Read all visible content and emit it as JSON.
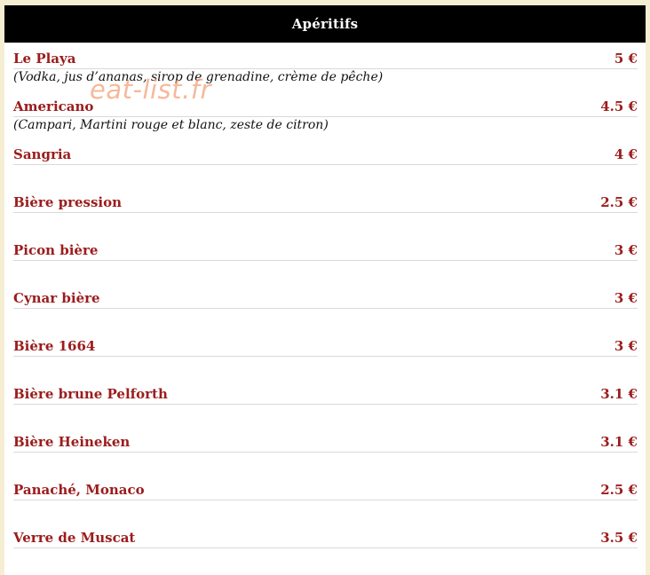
{
  "header": {
    "title": "Apéritifs"
  },
  "watermark": "eat-list.fr",
  "items": [
    {
      "name": "Le Playa",
      "price": "5 €",
      "desc": "(Vodka, jus d’ananas, sirop de grenadine, crème de pêche)"
    },
    {
      "name": "Americano",
      "price": "4.5 €",
      "desc": "(Campari, Martini rouge et blanc, zeste de citron)"
    },
    {
      "name": "Sangria",
      "price": "4 €",
      "desc": ""
    },
    {
      "name": "Bière pression",
      "price": "2.5 €",
      "desc": ""
    },
    {
      "name": "Picon bière",
      "price": "3 €",
      "desc": ""
    },
    {
      "name": "Cynar bière",
      "price": "3 €",
      "desc": ""
    },
    {
      "name": "Bière 1664",
      "price": "3 €",
      "desc": ""
    },
    {
      "name": "Bière brune Pelforth",
      "price": "3.1 €",
      "desc": ""
    },
    {
      "name": "Bière Heineken",
      "price": "3.1 €",
      "desc": ""
    },
    {
      "name": "Panaché, Monaco",
      "price": "2.5 €",
      "desc": ""
    },
    {
      "name": "Verre de Muscat",
      "price": "3.5 €",
      "desc": ""
    }
  ]
}
